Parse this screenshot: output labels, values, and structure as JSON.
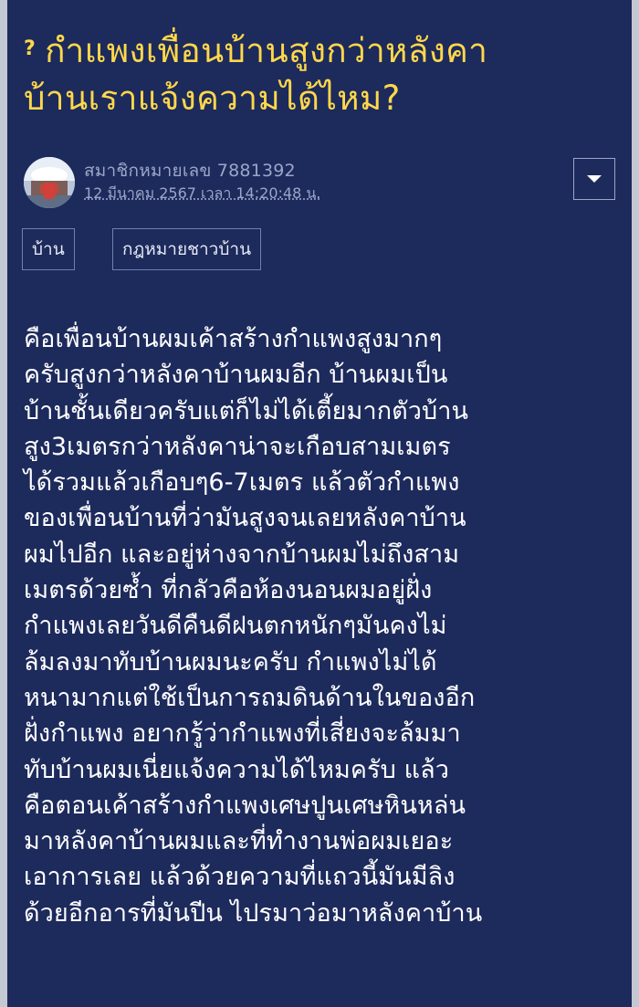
{
  "topic": {
    "title_line_1": "กำแพงเพื่อนบ้านสูงกว่าหลังคา",
    "title_line_2": "บ้านเราแจ้งความได้ไหม?",
    "icon": "question-icon"
  },
  "author": {
    "name": "สมาชิกหมายเลข 7881392",
    "timestamp": "12 มีนาคม 2567 เวลา 14:20:48 น."
  },
  "menu": {
    "icon": "caret-down-icon"
  },
  "tags": [
    "บ้าน",
    "กฎหมายชาวบ้าน"
  ],
  "content": {
    "lines": [
      "คือเพื่อนบ้านผมเค้าสร้างกำแพงสูงมากๆ",
      "ครับสูงกว่าหลังคาบ้านผมอีก บ้านผมเป็น",
      "บ้านชั้นเดียวครับแต่ก็ไม่ได้เตี้ยมากตัวบ้าน",
      "สูง3เมตรกว่าหลังคาน่าจะเกือบสามเมตร",
      "ได้รวมแล้วเกือบๆ6-7เมตร แล้วตัวกำแพง",
      "ของเพื่อนบ้านที่ว่ามันสูงจนเลยหลังคาบ้าน",
      "ผมไปอีก และอยู่ห่างจากบ้านผมไม่ถึงสาม",
      "เมตรด้วยซ้ำ ที่กลัวคือห้องนอนผมอยู่ฝั่ง",
      "กำแพงเลยวันดีคืนดีฝนตกหนักๆมันคงไม่",
      "ล้มลงมาทับบ้านผมนะครับ กำแพงไม่ได้",
      "หนามากแต่ใช้เป็นการถมดินด้านในของอีก",
      "ฝั่งกำแพง อยากรู้ว่ากำแพงที่เสี่ยงจะล้มมา",
      "ทับบ้านผมเนี่ยแจ้งความได้ไหมครับ แล้ว",
      "คือตอนเค้าสร้างกำแพงเศษปูนเศษหินหล่น",
      "มาหลังคาบ้านผมและที่ทำงานพ่อผมเยอะ",
      "เอาการเลย แล้วด้วยความที่แถวนี้มันมีลิง",
      "ด้วยอีกอารที่มันปีน ไปรมาว่อมาหลังคาบ้าน"
    ]
  },
  "colors": {
    "background": "#1d2a5c",
    "title": "#ffd84a",
    "meta": "#9ba6c8",
    "body": "#ffffff"
  }
}
